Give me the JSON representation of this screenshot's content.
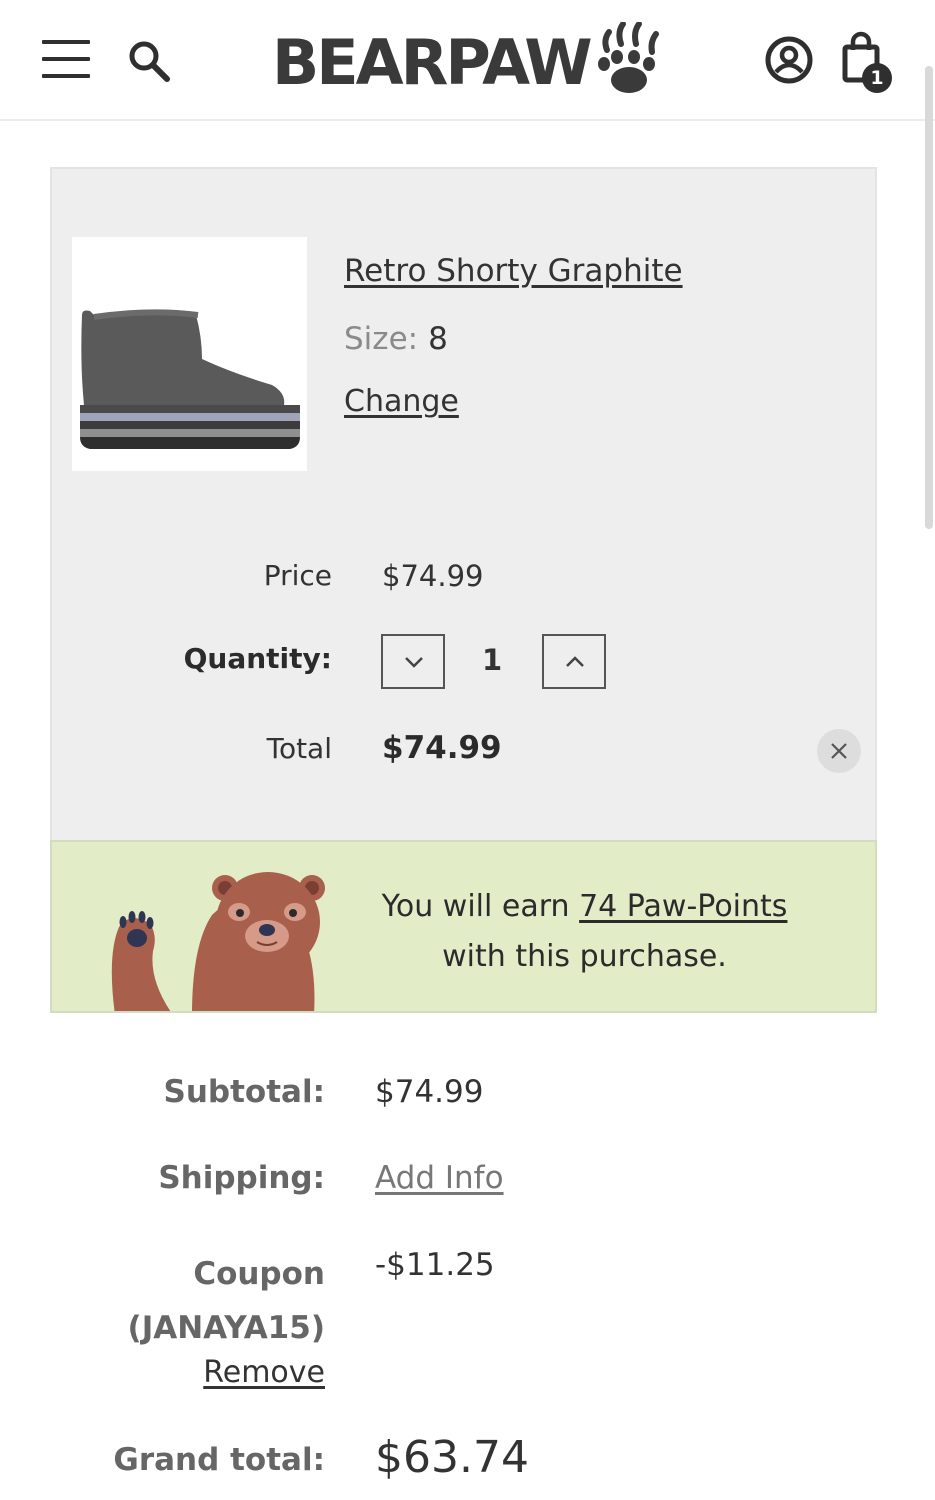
{
  "header": {
    "logo_text": "BEARPAW",
    "cart_count": "1",
    "icons": [
      "menu-icon",
      "search-icon",
      "paw-logo-icon",
      "account-icon",
      "shopping-bag-icon"
    ]
  },
  "cart_item": {
    "name": "Retro Shorty Graphite",
    "size_label": "Size:",
    "size_value": "8",
    "change_label": "Change",
    "price_label": "Price",
    "price_value": "$74.99",
    "quantity_label": "Quantity:",
    "quantity_value": "1",
    "total_label": "Total",
    "total_value": "$74.99"
  },
  "points": {
    "prefix": "You will earn ",
    "link": "74 Paw-Points",
    "suffix": "with this purchase."
  },
  "summary": {
    "subtotal_label": "Subtotal:",
    "subtotal_value": "$74.99",
    "shipping_label": "Shipping:",
    "shipping_value": "Add Info",
    "coupon_label_line1": "Coupon",
    "coupon_label_line2": "(JANAYA15)",
    "coupon_value": "-$11.25",
    "coupon_remove": "Remove",
    "grand_total_label": "Grand total:",
    "grand_total_value": "$63.74"
  },
  "colors": {
    "panel_bg": "#eeeeee",
    "banner_bg": "#e2ecc7",
    "bear_brown": "#a85f4c",
    "text_dark": "#2b2b2b"
  }
}
